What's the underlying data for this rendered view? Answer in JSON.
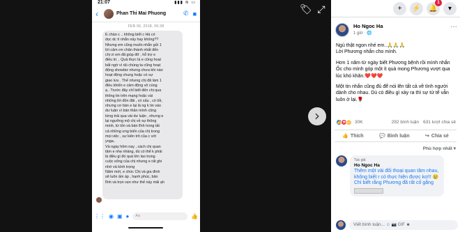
{
  "viewer": {
    "next_glyph": "›",
    "phone": {
      "status_time": "21:07",
      "status_icons": "▮▮▮ ≋ ▭",
      "chat_name": "Phan Thi Mai Phuong",
      "date_divider": "FEB 06, 2018, 06:38",
      "message": "E chào c .. không biết c Hà có\ndọc dc tí nhắn này hay không??\nNhưng em cũng muốn nhắn gửi 1\nlời cảm ơn chân thành nhất đến\nchị vì em đã giúp đỡ , hỗ trợ e\nđiều trị .. Quả thực là e cũng hoạt\nbất ngờ vì dù chúng ta cũng hoạt\nđộng showbiz nhưng chưa khi nào\nhoạt động chung hoặc có sự\ngiao lưu . Thế nhưng chị đã làm 1\nđiều khiến e cảm động vô cùng\nạ.. Trước đây chỉ biết đến chị qua\nthông tin trên mạng hoặc vài\nnhững lời đồn đãi , có xấu , có tốt,\nnhưng cơ bản e lại là ng k tin vào\ndư luận vì bản thân mình cũng\ntừng trải qua vài dư luận , nhưng e\nlại ngưỡng mộ chị về sự thông\nminh, từ tốn và bản lĩnh trong tất\ncả những ưng biến của chị trong\nmọi việc , sự kiên trõ của c với\nyoga..\nVà ngày hôm nay , cách chị quan\ntâm e nhẹ nhàng, dù có thể k phải\nlà điều gì đó quá lớn lao trong\ncuộc sống của chị nhưng e rất ghi\nnhớ và kính trọng\nNăm mới, e chúc Chị và gia đình\nsẽ luôn ấm áp , hạnh phúc, bản\nlĩnh và trọn vẹn như thế này mãi ạh",
      "composer_placeholder": "Aa"
    }
  },
  "topbar": {
    "icons": [
      "plus-icon",
      "messenger-icon",
      "bell-icon",
      "chevron-down-icon"
    ],
    "notifications": "1"
  },
  "post": {
    "author": "Ho Ngoc Ha",
    "time": "1 giờ · 🌐",
    "paragraphs": [
      "Ngủ thật ngon nhé em..🙏🙏🙏\nLời Phương nhắn cho mình.",
      "Hơn 1 năm từ ngày biết Phương bệnh rồi mình nhắn Ốc cho mình góp một ít quà mong Phương vượt qua lúc khó khăn.❤️❤️❤️",
      "Một tin nhắn cũng đủ để nói lên tất cả về tình người dành cho nhau. Dù có điều gì xảy ra thì sự tử tế vẫn luôn ở lại.🌹"
    ],
    "reaction_count": "30K",
    "comment_count": "292 bình luận",
    "share_count": "631 lượt chia sẻ",
    "actions": {
      "like": "Thích",
      "comment": "Bình luận",
      "share": "Chia sẻ"
    },
    "sort_label": "Phù hợp nhất ▾"
  },
  "comment": {
    "author_tag": "Tác giả",
    "author": "Ho Ngoc Ha",
    "text": "Thêm một vài đối thoại quan tâm nhau, không biết r có thực hiện được ko!!! 😢\nChỉ biết rằng Phương đã rất cố gắng"
  },
  "comment_box": {
    "placeholder": "Viết bình luận...",
    "icons": "☺ 📷 GIF ☻"
  }
}
